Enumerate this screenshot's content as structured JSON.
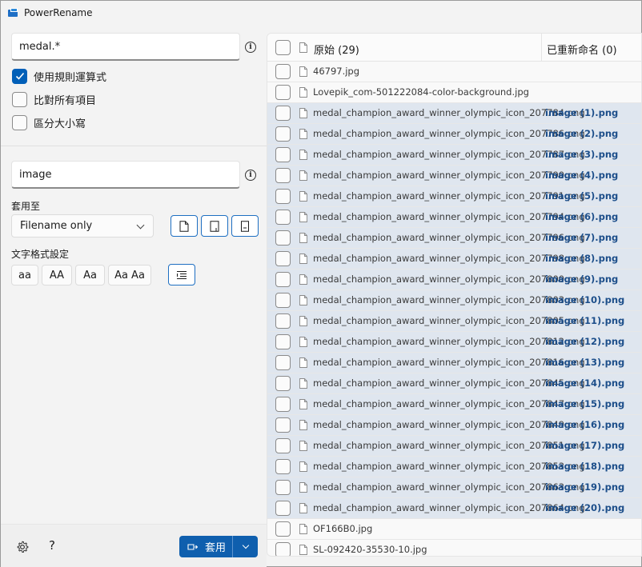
{
  "window": {
    "title": "PowerRename"
  },
  "search": {
    "value": "medal.*"
  },
  "options": [
    {
      "label": "使用規則運算式",
      "checked": true
    },
    {
      "label": "比對所有項目",
      "checked": false
    },
    {
      "label": "區分大小寫",
      "checked": false
    }
  ],
  "replace": {
    "value": "image"
  },
  "apply_to": {
    "caption": "套用至",
    "selected": "Filename only"
  },
  "text_format": {
    "caption": "文字格式設定",
    "buttons": [
      "aa",
      "AA",
      "Aa",
      "Aa Aa"
    ]
  },
  "footer": {
    "help": "?",
    "apply_label": "套用"
  },
  "list": {
    "header_original": "原始 (29)",
    "header_renamed": "已重新命名 (0)",
    "rows": [
      {
        "original": "46797.jpg",
        "renamed": "",
        "selected": false
      },
      {
        "original": "Lovepik_com-501222084-color-background.jpg",
        "renamed": "",
        "selected": false
      },
      {
        "original": "medal_champion_award_winner_olympic_icon_207784.png",
        "renamed": "image (1).png",
        "selected": true
      },
      {
        "original": "medal_champion_award_winner_olympic_icon_207786.png",
        "renamed": "image (2).png",
        "selected": true
      },
      {
        "original": "medal_champion_award_winner_olympic_icon_207787.png",
        "renamed": "image (3).png",
        "selected": true
      },
      {
        "original": "medal_champion_award_winner_olympic_icon_207790.png",
        "renamed": "image (4).png",
        "selected": true
      },
      {
        "original": "medal_champion_award_winner_olympic_icon_207791.png",
        "renamed": "image (5).png",
        "selected": true
      },
      {
        "original": "medal_champion_award_winner_olympic_icon_207794.png",
        "renamed": "image (6).png",
        "selected": true
      },
      {
        "original": "medal_champion_award_winner_olympic_icon_207796.png",
        "renamed": "image (7).png",
        "selected": true
      },
      {
        "original": "medal_champion_award_winner_olympic_icon_207798.png",
        "renamed": "image (8).png",
        "selected": true
      },
      {
        "original": "medal_champion_award_winner_olympic_icon_207800.png",
        "renamed": "image (9).png",
        "selected": true
      },
      {
        "original": "medal_champion_award_winner_olympic_icon_207803.png",
        "renamed": "image (10).png",
        "selected": true
      },
      {
        "original": "medal_champion_award_winner_olympic_icon_207805.png",
        "renamed": "image (11).png",
        "selected": true
      },
      {
        "original": "medal_champion_award_winner_olympic_icon_207812.png",
        "renamed": "image (12).png",
        "selected": true
      },
      {
        "original": "medal_champion_award_winner_olympic_icon_207816.png",
        "renamed": "image (13).png",
        "selected": true
      },
      {
        "original": "medal_champion_award_winner_olympic_icon_207845.png",
        "renamed": "image (14).png",
        "selected": true
      },
      {
        "original": "medal_champion_award_winner_olympic_icon_207847.png",
        "renamed": "image (15).png",
        "selected": true
      },
      {
        "original": "medal_champion_award_winner_olympic_icon_207849.png",
        "renamed": "image (16).png",
        "selected": true
      },
      {
        "original": "medal_champion_award_winner_olympic_icon_207851.png",
        "renamed": "image (17).png",
        "selected": true
      },
      {
        "original": "medal_champion_award_winner_olympic_icon_207853.png",
        "renamed": "image (18).png",
        "selected": true
      },
      {
        "original": "medal_champion_award_winner_olympic_icon_207863.png",
        "renamed": "image (19).png",
        "selected": true
      },
      {
        "original": "medal_champion_award_winner_olympic_icon_207864.png",
        "renamed": "image (20).png",
        "selected": true
      },
      {
        "original": "OF166B0.jpg",
        "renamed": "",
        "selected": false
      },
      {
        "original": "SL-092420-35530-10.jpg",
        "renamed": "",
        "selected": false
      }
    ]
  },
  "colors": {
    "accent": "#005fb8",
    "selected_row": "#dfe6ef",
    "renamed_text": "#1c4e8a"
  }
}
